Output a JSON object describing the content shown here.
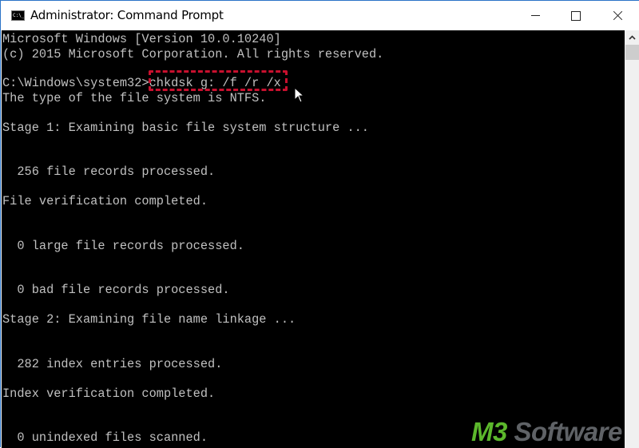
{
  "window": {
    "title": "Administrator: Command Prompt",
    "icon": "cmd-icon",
    "icon_text": "C:\\_",
    "controls": {
      "minimize": "minimize-icon",
      "maximize": "maximize-icon",
      "close": "close-icon"
    }
  },
  "console": {
    "lines": [
      "Microsoft Windows [Version 10.0.10240]",
      "(c) 2015 Microsoft Corporation. All rights reserved.",
      "",
      "C:\\Windows\\system32>chkdsk g: /f /r /x",
      "The type of the file system is NTFS.",
      "",
      "Stage 1: Examining basic file system structure ...",
      "",
      "",
      "  256 file records processed.",
      "",
      "File verification completed.",
      "",
      "",
      "  0 large file records processed.",
      "",
      "",
      "  0 bad file records processed.",
      "",
      "Stage 2: Examining file name linkage ...",
      "",
      "",
      "  282 index entries processed.",
      "",
      "Index verification completed.",
      "",
      "",
      "  0 unindexed files scanned."
    ],
    "prompt": "C:\\Windows\\system32>",
    "highlighted_command": "chkdsk g: /f /r /x",
    "highlight_color": "#c8102e",
    "background_color": "#000000",
    "text_color": "#c0c0c0"
  },
  "scrollbar": {
    "up_icon": "chevron-up-icon"
  },
  "watermark": {
    "brand_part1": "M3",
    "brand_part2": " Software",
    "color_part1": "#5cb82c",
    "color_part2": "#5f6266"
  }
}
